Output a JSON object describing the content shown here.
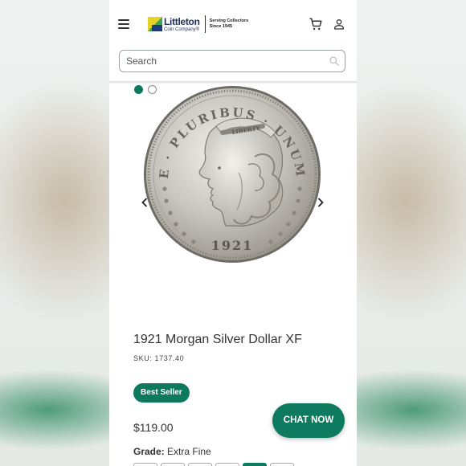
{
  "header": {
    "logo": {
      "name": "Littleton",
      "sub": "Coin Company",
      "tagline_line1": "Serving Collectors",
      "tagline_line2": "Since 1945"
    },
    "icons": [
      "menu-icon",
      "cart-icon",
      "user-icon"
    ]
  },
  "search": {
    "placeholder": "Search"
  },
  "gallery": {
    "image_count": 2,
    "active_index": 0,
    "coin": {
      "legend": "E · PLURIBUS · UNUM",
      "headband": "LIBERTY",
      "date": "1921"
    }
  },
  "product": {
    "title": "1921 Morgan Silver Dollar XF",
    "sku": "SKU: 1737.40",
    "badge": "Best Seller",
    "price": "$119.00",
    "grade_label": "Grade:",
    "grade_value": " Extra Fine"
  },
  "chat": {
    "label": "CHAT NOW"
  },
  "colors": {
    "brand_green": "#0d7a5f",
    "logo_navy": "#1d2f5e"
  }
}
